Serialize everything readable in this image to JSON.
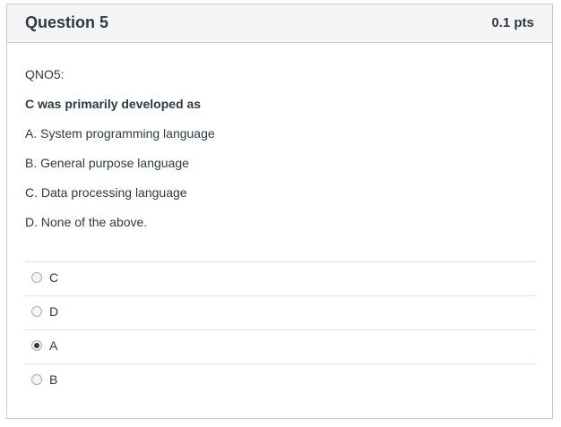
{
  "question": {
    "title": "Question 5",
    "points": "0.1 pts",
    "qno": "QNO5:",
    "stem": "C was primarily developed as",
    "options_text": [
      "A. System programming language",
      "B. General purpose language",
      "C. Data processing language",
      "D. None of the above."
    ]
  },
  "answers": [
    {
      "label": "C",
      "selected": false
    },
    {
      "label": "D",
      "selected": false
    },
    {
      "label": "A",
      "selected": true
    },
    {
      "label": "B",
      "selected": false
    }
  ]
}
